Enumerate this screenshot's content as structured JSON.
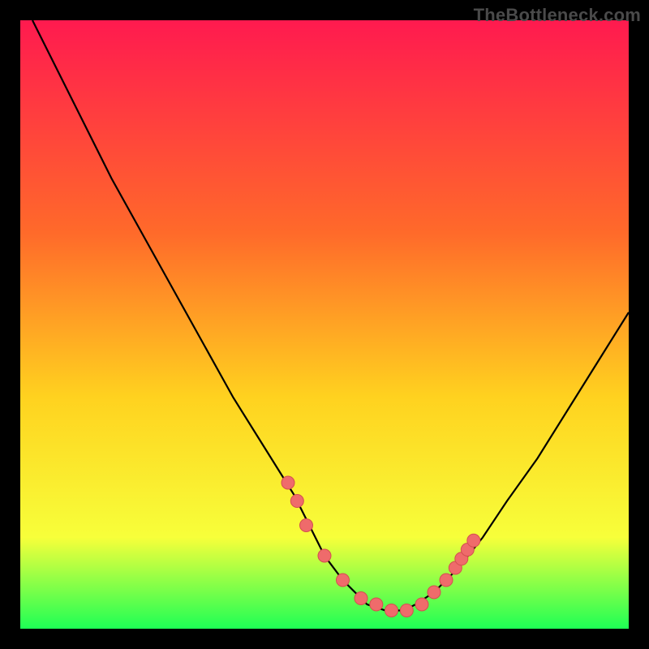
{
  "watermark": "TheBottleneck.com",
  "colors": {
    "background": "#000000",
    "gradient_top": "#ff1a4f",
    "gradient_mid1": "#ff6a2a",
    "gradient_mid2": "#ffd21f",
    "gradient_mid3": "#f7ff3a",
    "gradient_bottom": "#1eff55",
    "curve": "#000000",
    "marker_fill": "#ef6b6b",
    "marker_stroke": "#d44f4f"
  },
  "chart_data": {
    "type": "line",
    "title": "",
    "xlabel": "",
    "ylabel": "",
    "xlim": [
      0,
      100
    ],
    "ylim": [
      0,
      100
    ],
    "series": [
      {
        "name": "bottleneck-curve",
        "x": [
          2,
          5,
          10,
          15,
          20,
          25,
          30,
          35,
          40,
          45,
          48,
          50,
          53,
          55,
          57,
          60,
          63,
          65,
          68,
          72,
          76,
          80,
          85,
          90,
          95,
          100
        ],
        "y": [
          100,
          94,
          84,
          74,
          65,
          56,
          47,
          38,
          30,
          22,
          16,
          12,
          8,
          6,
          4,
          3,
          3,
          4,
          6,
          10,
          15,
          21,
          28,
          36,
          44,
          52
        ]
      }
    ],
    "markers": {
      "name": "highlighted-points",
      "x": [
        44,
        45.5,
        47,
        50,
        53,
        56,
        58.5,
        61,
        63.5,
        66,
        68,
        70,
        71.5,
        72.5,
        73.5,
        74.5
      ],
      "y": [
        24,
        21,
        17,
        12,
        8,
        5,
        4,
        3,
        3,
        4,
        6,
        8,
        10,
        11.5,
        13,
        14.5
      ]
    }
  }
}
